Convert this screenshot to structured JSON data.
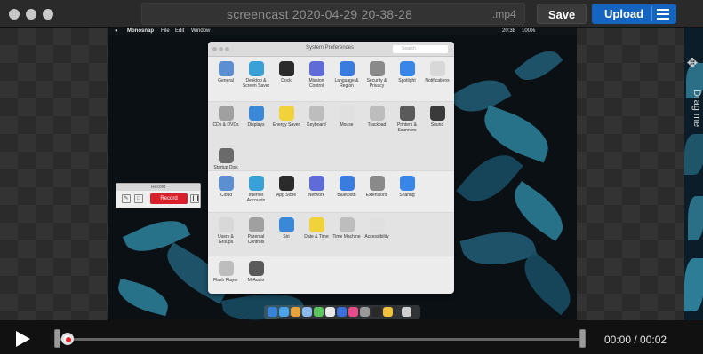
{
  "window": {
    "filename": "screencast 2020-04-29 20-38-28",
    "extension": ".mp4",
    "save_label": "Save",
    "upload_label": "Upload"
  },
  "side_panel": {
    "drag_label": "Drag me"
  },
  "desktop": {
    "menubar": {
      "app": "Monosnap",
      "items": [
        "File",
        "Edit",
        "Window"
      ],
      "clock": "20:38",
      "battery": "100%"
    },
    "prefs": {
      "title": "System Preferences",
      "search_placeholder": "Search",
      "sections": [
        [
          "General",
          "Desktop & Screen Saver",
          "Dock",
          "Mission Control",
          "Language & Region",
          "Security & Privacy",
          "Spotlight",
          "Notifications"
        ],
        [
          "CDs & DVDs",
          "Displays",
          "Energy Saver",
          "Keyboard",
          "Mouse",
          "Trackpad",
          "Printers & Scanners",
          "Sound",
          "Startup Disk"
        ],
        [
          "iCloud",
          "Internet Accounts",
          "App Store",
          "Network",
          "Bluetooth",
          "Extensions",
          "Sharing"
        ],
        [
          "Users & Groups",
          "Parental Controls",
          "Siri",
          "Date & Time",
          "Time Machine",
          "Accessibility"
        ],
        [
          "Flash Player",
          "M-Audio"
        ]
      ]
    },
    "record_widget": {
      "title": "Record",
      "record_label": "Record"
    }
  },
  "player": {
    "time": "00:00 / 00:02",
    "progress": 0.0
  },
  "colors": {
    "accent": "#1565c0",
    "record": "#d8202a"
  }
}
